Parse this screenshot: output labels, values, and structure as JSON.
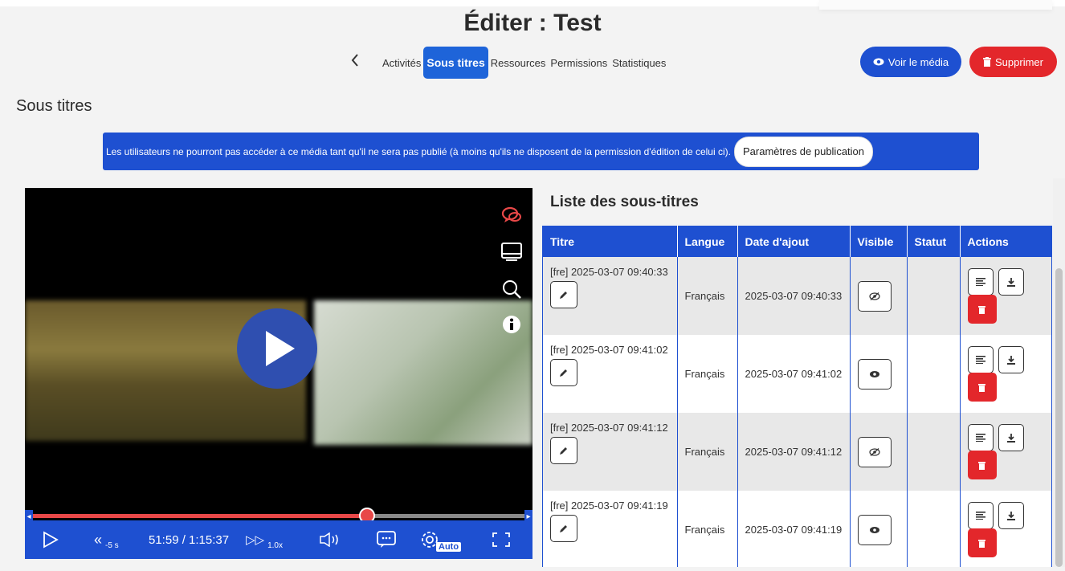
{
  "header": {
    "title": "Éditer : Test",
    "back_icon": "chevron-left-icon",
    "tabs": [
      {
        "label": "Activités",
        "active": false
      },
      {
        "label": "Sous titres",
        "active": true
      },
      {
        "label": "Ressources",
        "active": false
      },
      {
        "label": "Permissions",
        "active": false
      },
      {
        "label": "Statistiques",
        "active": false
      }
    ],
    "view_media_label": "Voir le média",
    "delete_label": "Supprimer"
  },
  "section": {
    "title": "Sous titres"
  },
  "notice": {
    "text": "Les utilisateurs ne pourront pas accéder à ce média tant qu'il ne sera pas publié (à moins qu'ils ne disposent de la permission d'édition de celui ci).",
    "button_label": "Paramètres de publication"
  },
  "player": {
    "current_time": "51:59",
    "total_time": "1:15:37",
    "time_display": "51:59 / 1:15:37",
    "rewind_label": "-5 s",
    "speed_label": "1.0x",
    "quality_label": "Auto",
    "progress_fraction": 0.68,
    "side_icons": [
      "chat-icon",
      "screen-icon",
      "search-icon",
      "info-icon"
    ]
  },
  "subtitles": {
    "title": "Liste des sous-titres",
    "columns": [
      "Titre",
      "Langue",
      "Date d'ajout",
      "Visible",
      "Statut",
      "Actions"
    ],
    "rows": [
      {
        "title": "[fre] 2025-03-07 09:40:33",
        "language": "Français",
        "date": "2025-03-07 09:40:33",
        "visible": false,
        "status": ""
      },
      {
        "title": "[fre] 2025-03-07 09:41:02",
        "language": "Français",
        "date": "2025-03-07 09:41:02",
        "visible": true,
        "status": ""
      },
      {
        "title": "[fre] 2025-03-07 09:41:12",
        "language": "Français",
        "date": "2025-03-07 09:41:12",
        "visible": false,
        "status": ""
      },
      {
        "title": "[fre] 2025-03-07 09:41:19",
        "language": "Français",
        "date": "2025-03-07 09:41:19",
        "visible": true,
        "status": ""
      }
    ]
  },
  "colors": {
    "primary": "#1e50d1",
    "danger": "#e3272b",
    "progress": "#e84848"
  }
}
